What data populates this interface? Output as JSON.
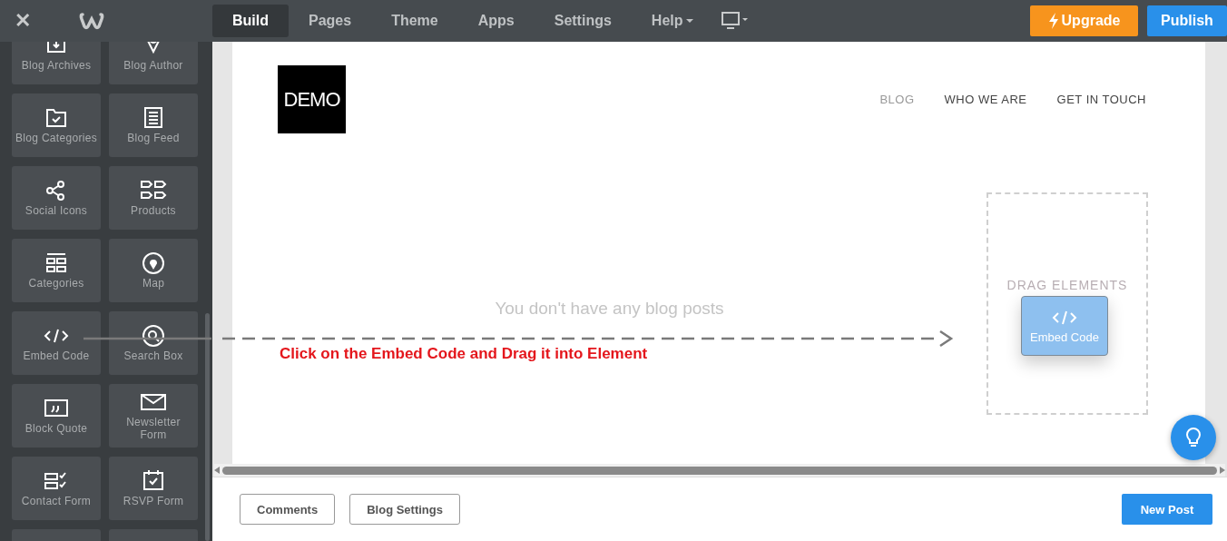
{
  "top_bar": {
    "close": "✕",
    "tabs": [
      {
        "label": "Build",
        "selected": true,
        "caret": false
      },
      {
        "label": "Pages",
        "selected": false,
        "caret": false
      },
      {
        "label": "Theme",
        "selected": false,
        "caret": false
      },
      {
        "label": "Apps",
        "selected": false,
        "caret": false
      },
      {
        "label": "Settings",
        "selected": false,
        "caret": false
      },
      {
        "label": "Help",
        "selected": false,
        "caret": true
      }
    ],
    "upgrade": "Upgrade",
    "publish": "Publish"
  },
  "sidebar": {
    "items": [
      {
        "kind": "archive",
        "label": "Blog Archives"
      },
      {
        "kind": "author",
        "label": "Blog Author"
      },
      {
        "kind": "folder",
        "label": "Blog Categories"
      },
      {
        "kind": "feed",
        "label": "Blog Feed"
      },
      {
        "kind": "share",
        "label": "Social Icons"
      },
      {
        "kind": "products",
        "label": "Products"
      },
      {
        "kind": "categories",
        "label": "Categories"
      },
      {
        "kind": "map",
        "label": "Map"
      },
      {
        "kind": "code",
        "label": "Embed Code"
      },
      {
        "kind": "search",
        "label": "Search Box"
      },
      {
        "kind": "quote",
        "label": "Block Quote"
      },
      {
        "kind": "envelope",
        "label": "Newsletter Form"
      },
      {
        "kind": "contact",
        "label": "Contact Form"
      },
      {
        "kind": "rsvp",
        "label": "RSVP Form"
      },
      {
        "kind": "blank"
      },
      {
        "kind": "blank"
      }
    ]
  },
  "page": {
    "logo": "DEMO",
    "nav": [
      {
        "label": "BLOG",
        "selected": true
      },
      {
        "label": "WHO WE ARE",
        "selected": false
      },
      {
        "label": "GET IN TOUCH",
        "selected": false
      }
    ],
    "empty_message": "You don't have any blog posts",
    "annotation": "Click on the Embed Code and Drag it into Element",
    "drop_zone": "DRAG ELEMENTS",
    "dragged_tile": "Embed Code"
  },
  "bottom_bar": {
    "buttons": [
      "Comments",
      "Blog Settings"
    ],
    "primary": "New Post"
  }
}
